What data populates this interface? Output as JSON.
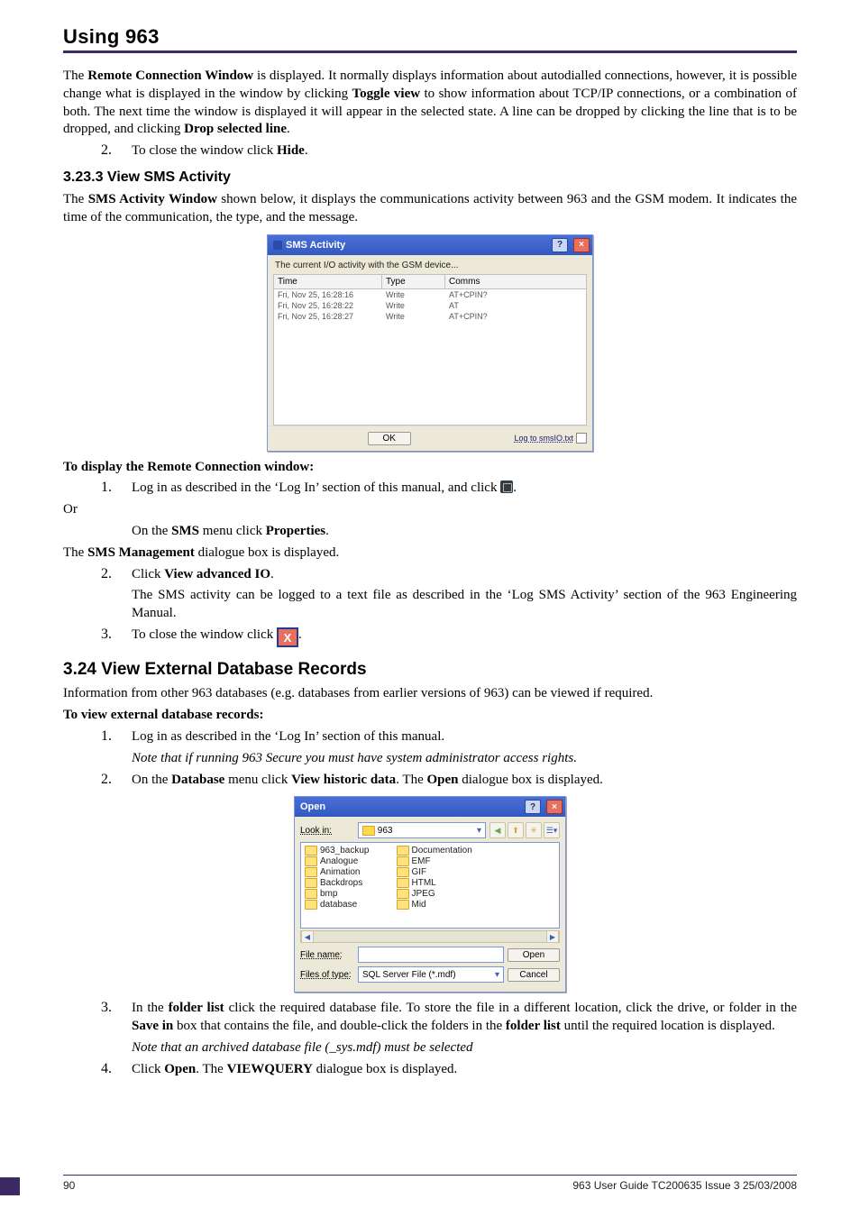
{
  "header": {
    "title": "Using 963"
  },
  "p1": {
    "seg1": "The ",
    "b1": "Remote Connection Window",
    "seg2": " is displayed. It normally displays information about autodialled connections, however, it is possible change what is displayed in the window by clicking ",
    "b2": "Toggle view",
    "seg3": " to show information about TCP/IP connections, or a combination of both. The next time the window is displayed it will appear in the selected state. A line can be dropped by clicking the line that is to be dropped, and clicking ",
    "b3": "Drop selected line",
    "seg4": "."
  },
  "li_close1": {
    "num": "2.",
    "pre": "To close the window click ",
    "b": "Hide",
    "post": "."
  },
  "h3_3233": "3.23.3   View SMS Activity",
  "p2": {
    "seg1": "The ",
    "b1": "SMS Activity Window",
    "seg2": " shown below, it displays the communications activity between 963 and the GSM modem. It indicates the time of the communication, the type, and the message."
  },
  "sms": {
    "title": "SMS Activity",
    "sub": "The current I/O activity with the GSM device...",
    "cols": {
      "time": "Time",
      "type": "Type",
      "comms": "Comms"
    },
    "rows": [
      {
        "time": "Fri, Nov 25, 16:28:16",
        "type": "Write",
        "comms": "AT+CPIN?"
      },
      {
        "time": "Fri, Nov 25, 16:28:22",
        "type": "Write",
        "comms": "AT"
      },
      {
        "time": "Fri, Nov 25, 16:28:27",
        "type": "Write",
        "comms": "AT+CPIN?"
      }
    ],
    "ok": "OK",
    "log": "Log to smsIO.txt"
  },
  "disp_heading": "To display the Remote Connection window:",
  "li_login1": {
    "num": "1.",
    "text": "Log in as described in the ‘Log In’ section of this manual, and click ",
    "post": "."
  },
  "or": "Or",
  "sms_menu": {
    "pre": "On the ",
    "b1": "SMS",
    "mid": " menu click ",
    "b2": "Properties",
    "post": "."
  },
  "sms_mgmt": {
    "pre": "The ",
    "b": "SMS Management",
    "post": " dialogue box is displayed."
  },
  "li_view_io": {
    "num": "2.",
    "pre": "Click ",
    "b": "View advanced IO",
    "post": "."
  },
  "sms_logged": "The SMS activity can be logged to a text file as described in the ‘Log SMS Activity’ section of the 963 Engineering Manual.",
  "li_close2": {
    "num": "3.",
    "text": "To close the window click ",
    "post": "."
  },
  "h2_324": "3.24  View External Database Records",
  "p_extdb": "Information from other 963 databases (e.g. databases from earlier versions of 963) can be viewed if required.",
  "view_heading": "To view external database records:",
  "li_login2": {
    "num": "1.",
    "text": "Log in as described in the ‘Log In’ section of this manual."
  },
  "note_secure": "Note that if running 963 Secure you must have system administrator access rights.",
  "li_db": {
    "num": "2.",
    "pre": "On the ",
    "b1": "Database",
    "mid": " menu click ",
    "b2": "View historic data",
    "mid2": ". The ",
    "b3": "Open",
    "post": " dialogue box is displayed."
  },
  "open": {
    "title": "Open",
    "lookin_label": "Look in:",
    "lookin_value": "963",
    "folders_left": [
      "963_backup",
      "Analogue",
      "Animation",
      "Backdrops",
      "bmp",
      "database"
    ],
    "folders_right": [
      "Documentation",
      "EMF",
      "GIF",
      "HTML",
      "JPEG",
      "Mid"
    ],
    "filename_label": "File name:",
    "filename_value": "",
    "filetype_label": "Files of type:",
    "filetype_value": "SQL Server File (*.mdf)",
    "open_btn": "Open",
    "cancel_btn": "Cancel"
  },
  "li_folder": {
    "num": "3.",
    "seg1": "In the ",
    "b1": "folder list",
    "seg2": " click the required database file. To store the file in a different location, click the drive, or folder in the ",
    "b2": "Save in",
    "seg3": " box that contains the file, and double-click the folders in the ",
    "b3": "folder list",
    "seg4": " until the required location is displayed."
  },
  "note_archived": "Note that an archived database file (_sys.mdf) must be selected",
  "li_open": {
    "num": "4.",
    "pre": "Click ",
    "b1": "Open",
    "mid": ". The ",
    "b2": "VIEWQUERY",
    "post": " dialogue box is displayed."
  },
  "footer": {
    "page": "90",
    "right": "963 User Guide TC200635 Issue 3 25/03/2008"
  }
}
